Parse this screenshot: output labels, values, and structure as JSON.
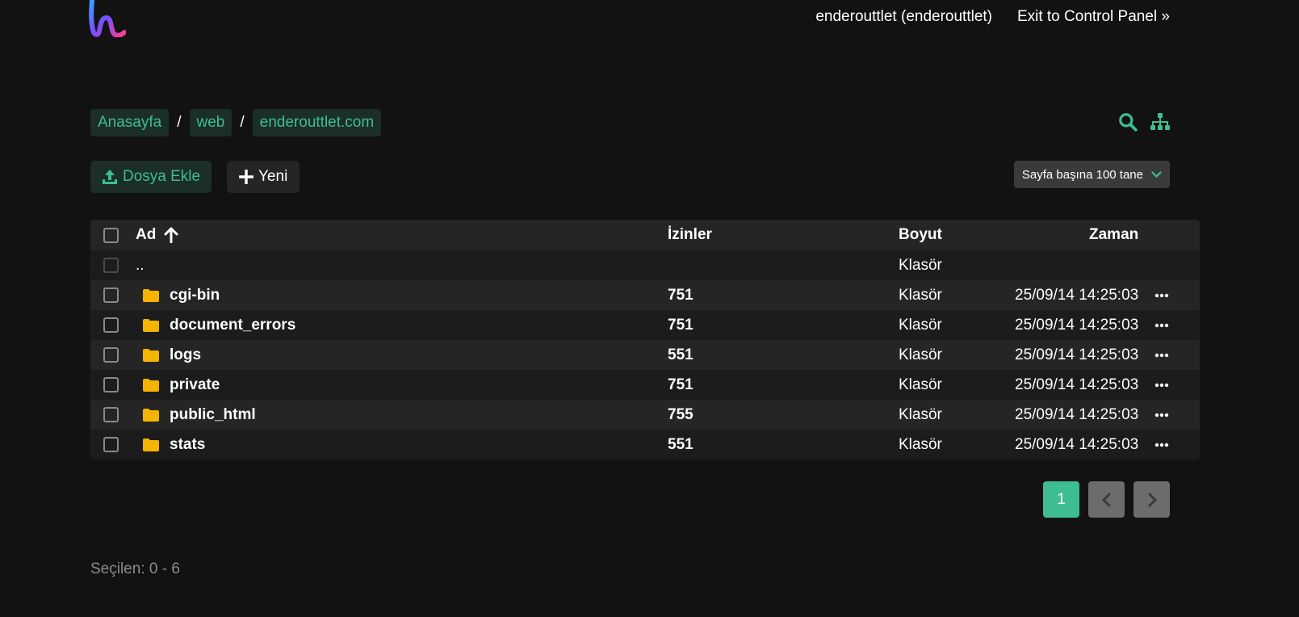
{
  "topbar": {
    "user": "enderouttlet (enderouttlet)",
    "exit": "Exit to Control Panel »"
  },
  "breadcrumb": [
    "Anasayfa",
    "web",
    "enderouttlet.com"
  ],
  "breadcrumb_sep": "/",
  "toolbar": {
    "upload_label": "Dosya Ekle",
    "new_label": "Yeni",
    "perpage_label": "Sayfa başına 100 tane"
  },
  "table": {
    "headers": {
      "name": "Ad",
      "perm": "İzinler",
      "size": "Boyut",
      "time": "Zaman"
    },
    "parent": {
      "name": "..",
      "size": "Klasör"
    },
    "rows": [
      {
        "name": "cgi-bin",
        "perm": "751",
        "size": "Klasör",
        "time": "25/09/14 14:25:03"
      },
      {
        "name": "document_errors",
        "perm": "751",
        "size": "Klasör",
        "time": "25/09/14 14:25:03"
      },
      {
        "name": "logs",
        "perm": "551",
        "size": "Klasör",
        "time": "25/09/14 14:25:03"
      },
      {
        "name": "private",
        "perm": "751",
        "size": "Klasör",
        "time": "25/09/14 14:25:03"
      },
      {
        "name": "public_html",
        "perm": "755",
        "size": "Klasör",
        "time": "25/09/14 14:25:03"
      },
      {
        "name": "stats",
        "perm": "551",
        "size": "Klasör",
        "time": "25/09/14 14:25:03"
      }
    ]
  },
  "pager": {
    "current": "1"
  },
  "footer": {
    "selected": "Seçilen: 0 - 6"
  },
  "colors": {
    "accent": "#3ebd93",
    "folder": "#f5b400",
    "background": "#121212"
  }
}
